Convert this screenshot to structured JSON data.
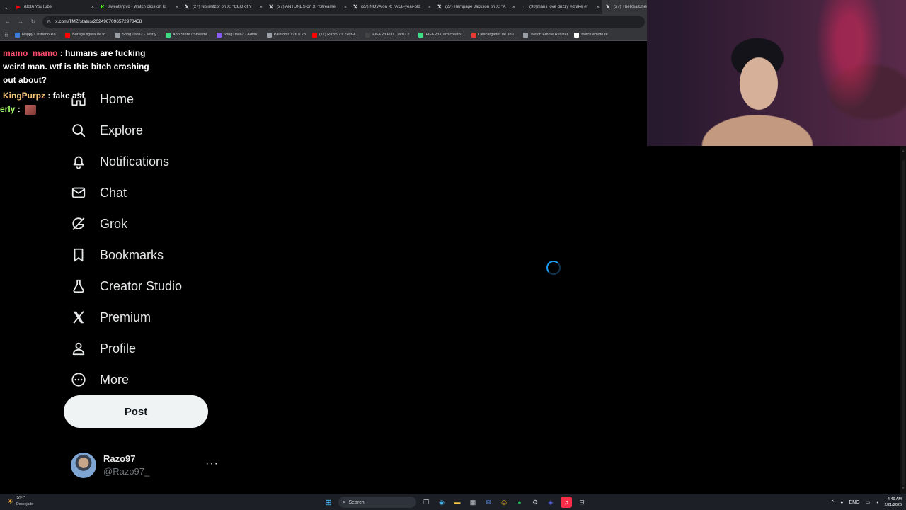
{
  "browser": {
    "tabs": [
      {
        "title": "(808) YouTube",
        "icon": "youtube-icon",
        "color": "#ff0000",
        "glyph": "▶"
      },
      {
        "title": "sweaterpvd - Watch clips on Ki",
        "icon": "kick-icon",
        "color": "#53fc18",
        "glyph": "K"
      },
      {
        "title": "(27) Nolimitzor on X: \"CEO of Y",
        "icon": "x-icon",
        "color": "#ffffff",
        "glyph": "𝕏"
      },
      {
        "title": "(27) ANTUNES on X: \"Streame",
        "icon": "x-icon",
        "color": "#ffffff",
        "glyph": "𝕏"
      },
      {
        "title": "(27) NOVA on X: \"A 58-year-old",
        "icon": "x-icon",
        "color": "#ffffff",
        "glyph": "𝕏"
      },
      {
        "title": "(27) Rampage Jackson on X: \"A",
        "icon": "x-icon",
        "color": "#ffffff",
        "glyph": "𝕏"
      },
      {
        "title": "(90)man i love drizzy #drake #r",
        "icon": "tiktok-icon",
        "color": "#ffffff",
        "glyph": "♪"
      },
      {
        "title": "(27) TheRealChew",
        "icon": "x-icon",
        "color": "#ffffff",
        "glyph": "𝕏"
      }
    ],
    "url": "x.com/TMZ/status/2024967096572973458",
    "bookmarks": [
      {
        "label": "Happy Cristiano Ro...",
        "color": "#3a7bd5"
      },
      {
        "label": "Burago figura de to...",
        "color": "#ff0000"
      },
      {
        "label": "SongTrivia2 - Test y...",
        "color": "#9aa0a6"
      },
      {
        "label": "App Store / Streami...",
        "color": "#3ddc84"
      },
      {
        "label": "SongTrivia2 - Advin...",
        "color": "#8a5cf6"
      },
      {
        "label": "Paletools v26.0.28",
        "color": "#9aa0a6"
      },
      {
        "label": "(77) Razo97's Zest-A...",
        "color": "#ff0000"
      },
      {
        "label": "FIFA 23 FUT Card Cr...",
        "color": "#444444"
      },
      {
        "label": "FIFA 23 Card creator...",
        "color": "#3ddc84"
      },
      {
        "label": "Descargador de You...",
        "color": "#e53935"
      },
      {
        "label": "Twitch Emote Resizer",
        "color": "#9aa0a6"
      },
      {
        "label": "twitch emote re",
        "color": "#ffffff"
      }
    ]
  },
  "chat": {
    "messages": [
      {
        "user": "mamo_mamo",
        "sep": " : ",
        "text": "humans are fucking weird man. wtf is this bitch crashing out about?"
      },
      {
        "user": "KingPurpz",
        "sep": " : ",
        "text": "fake asf"
      },
      {
        "user": "erly",
        "sep": " : ",
        "text": ""
      }
    ]
  },
  "nav": {
    "items": [
      {
        "label": "Home",
        "icon": "home-icon"
      },
      {
        "label": "Explore",
        "icon": "search-icon"
      },
      {
        "label": "Notifications",
        "icon": "bell-icon"
      },
      {
        "label": "Chat",
        "icon": "envelope-icon"
      },
      {
        "label": "Grok",
        "icon": "grok-icon"
      },
      {
        "label": "Bookmarks",
        "icon": "bookmark-icon"
      },
      {
        "label": "Creator Studio",
        "icon": "creator-studio-icon"
      },
      {
        "label": "Premium",
        "icon": "x-logo-icon"
      },
      {
        "label": "Profile",
        "icon": "person-icon"
      },
      {
        "label": "More",
        "icon": "more-circle-icon"
      }
    ],
    "post_label": "Post"
  },
  "account": {
    "name": "Razo97",
    "handle": "@Razo97_",
    "more": "···"
  },
  "taskbar": {
    "temp": "20°C",
    "weather": "Despejado",
    "search": "Search",
    "lang": "ENG",
    "time": "4:49 AM",
    "date": "2/21/2026"
  },
  "colors": {
    "accent": "#1d9bf0",
    "post_button": "#eff3f4",
    "background": "#000000"
  }
}
